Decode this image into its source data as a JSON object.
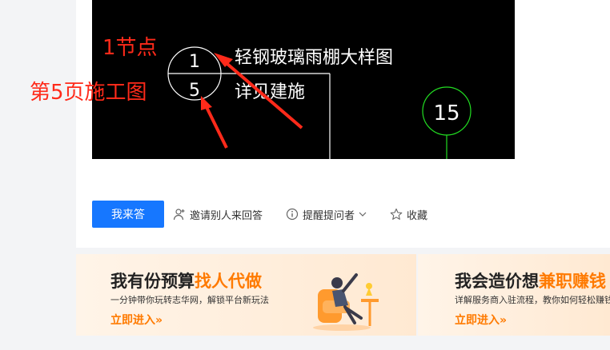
{
  "drawing": {
    "detail_number": "1",
    "detail_title": "轻钢玻璃雨棚大样图",
    "sheet_number": "5",
    "sheet_note": "详见建施",
    "axis_number": "15",
    "line_color": "#ffffff",
    "axis_color": "#22dd22",
    "background": "#000000"
  },
  "annotations": {
    "node_label": "1节点",
    "page_label": "第5页施工图",
    "color": "#ff2a1a"
  },
  "actions": {
    "answer_button": "我来答",
    "invite": "邀请别人来回答",
    "remind": "提醒提问者",
    "favorite": "收藏",
    "icons": [
      "user-add-icon",
      "info-icon",
      "chevron-down-icon",
      "star-icon"
    ],
    "accent": "#1677ff"
  },
  "promos": [
    {
      "title_plain": "我有份预算",
      "title_highlight": "找人代做",
      "subtitle": "一分钟带你玩转志华网，解锁平台新玩法",
      "link": "立即进入»"
    },
    {
      "title_plain": "我会造价想",
      "title_highlight": "兼职赚钱",
      "subtitle": "详解服务商入驻流程，教你如何轻松赚钱",
      "link": "立即进入»"
    }
  ],
  "promo_accent": "#ff7a00"
}
